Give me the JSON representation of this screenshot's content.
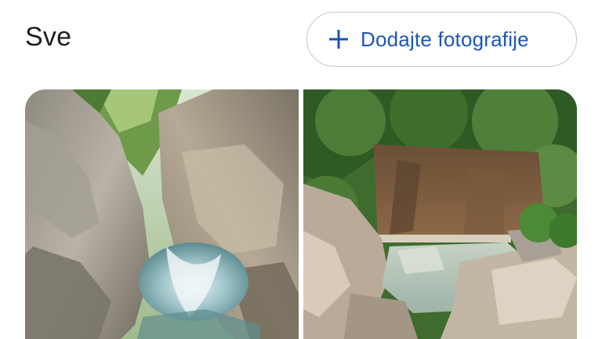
{
  "section": {
    "title": "Sve"
  },
  "toolbar": {
    "add_photos_label": "Dodajte fotografije",
    "add_icon": "plus-icon",
    "accent_color": "#1a56b8"
  },
  "photos": [
    {
      "subject": "canyon-river-photo"
    },
    {
      "subject": "waterfall-pool-photo"
    }
  ]
}
